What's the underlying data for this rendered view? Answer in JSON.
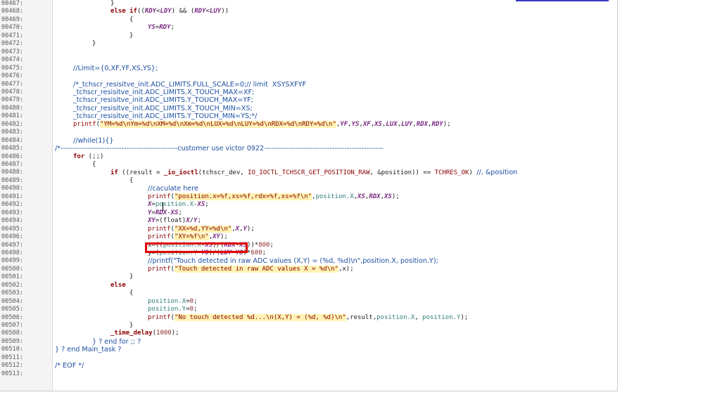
{
  "editor": {
    "lines": [
      {
        "num": "00467:",
        "indent": 157,
        "tokens": [
          {
            "t": "}",
            "c": "p"
          }
        ]
      },
      {
        "num": "00468:",
        "indent": 157,
        "tokens": [
          {
            "t": "else if",
            "c": "k"
          },
          {
            "t": "((",
            "c": "p"
          },
          {
            "t": "RDY",
            "c": "v"
          },
          {
            "t": "<",
            "c": "p"
          },
          {
            "t": "LDY",
            "c": "v"
          },
          {
            "t": ") && (",
            "c": "p"
          },
          {
            "t": "RDY",
            "c": "v"
          },
          {
            "t": "<",
            "c": "p"
          },
          {
            "t": "LUY",
            "c": "v"
          },
          {
            "t": "))",
            "c": "p"
          }
        ]
      },
      {
        "num": "00469:",
        "indent": 184,
        "tokens": [
          {
            "t": "{",
            "c": "p"
          }
        ]
      },
      {
        "num": "00470:",
        "indent": 210,
        "tokens": [
          {
            "t": "YS",
            "c": "v"
          },
          {
            "t": "=",
            "c": "p"
          },
          {
            "t": "RDY",
            "c": "v"
          },
          {
            "t": ";",
            "c": "p"
          }
        ]
      },
      {
        "num": "00471:",
        "indent": 184,
        "tokens": [
          {
            "t": "}",
            "c": "p"
          }
        ]
      },
      {
        "num": "00472:",
        "indent": 131,
        "tokens": [
          {
            "t": "}",
            "c": "p"
          }
        ]
      },
      {
        "num": "00473:",
        "indent": 0,
        "tokens": []
      },
      {
        "num": "00474:",
        "indent": 0,
        "tokens": []
      },
      {
        "num": "00475:",
        "indent": 104,
        "tokens": [
          {
            "t": "//Limit={0,XF,YF,XS,YS};",
            "c": "a"
          }
        ]
      },
      {
        "num": "00476:",
        "indent": 0,
        "tokens": []
      },
      {
        "num": "00477:",
        "indent": 104,
        "tokens": [
          {
            "t": "/*_tchscr_resisitve_init.ADC_LIMITS.FULL_SCALE=0;// limit  XSYSXFYF",
            "c": "a"
          }
        ]
      },
      {
        "num": "00478:",
        "indent": 104,
        "tokens": [
          {
            "t": "_tchscr_resisitve_init.ADC_LIMITS.X_TOUCH_MAX=XF;",
            "c": "a"
          }
        ]
      },
      {
        "num": "00479:",
        "indent": 104,
        "tokens": [
          {
            "t": "_tchscr_resisitve_init.ADC_LIMITS.Y_TOUCH_MAX=YF;",
            "c": "a"
          }
        ]
      },
      {
        "num": "00480:",
        "indent": 104,
        "tokens": [
          {
            "t": "_tchscr_resisitve_init.ADC_LIMITS.X_TOUCH_MIN=XS;",
            "c": "a"
          }
        ]
      },
      {
        "num": "00481:",
        "indent": 104,
        "tokens": [
          {
            "t": "_tchscr_resisitve_init.ADC_LIMITS.Y_TOUCH_MIN=YS;*/",
            "c": "a"
          }
        ]
      },
      {
        "num": "00482:",
        "indent": 104,
        "tokens": [
          {
            "t": "printf",
            "c": "f"
          },
          {
            "t": "(",
            "c": "p"
          },
          {
            "t": "\"YM=%d\\nYm=%d\\nXM=%d\\nXm=%d\\nLUX=%d\\nLUY=%d\\nRDX=%d\\nRDY=%d\\n\"",
            "c": "s"
          },
          {
            "t": ",",
            "c": "p"
          },
          {
            "t": "YF",
            "c": "v"
          },
          {
            "t": ",",
            "c": "p"
          },
          {
            "t": "YS",
            "c": "v"
          },
          {
            "t": ",",
            "c": "p"
          },
          {
            "t": "XF",
            "c": "v"
          },
          {
            "t": ",",
            "c": "p"
          },
          {
            "t": "XS",
            "c": "v"
          },
          {
            "t": ",",
            "c": "p"
          },
          {
            "t": "LUX",
            "c": "v"
          },
          {
            "t": ",",
            "c": "p"
          },
          {
            "t": "LUY",
            "c": "v"
          },
          {
            "t": ",",
            "c": "p"
          },
          {
            "t": "RDX",
            "c": "v"
          },
          {
            "t": ",",
            "c": "p"
          },
          {
            "t": "RDY",
            "c": "v"
          },
          {
            "t": ");",
            "c": "p"
          }
        ]
      },
      {
        "num": "00483:",
        "indent": 0,
        "tokens": []
      },
      {
        "num": "00484:",
        "indent": 104,
        "tokens": [
          {
            "t": "//while(1){}",
            "c": "a"
          }
        ]
      },
      {
        "num": "00485:",
        "indent": 78,
        "tokens": [
          {
            "t": "/*------------------------------------------------customer use victor 0922-------------------------------------------------",
            "c": "c"
          }
        ]
      },
      {
        "num": "00486:",
        "indent": 104,
        "tokens": [
          {
            "t": "for",
            "c": "k"
          },
          {
            "t": " (;;)",
            "c": "p"
          }
        ]
      },
      {
        "num": "00487:",
        "indent": 131,
        "tokens": [
          {
            "t": "{",
            "c": "p"
          }
        ]
      },
      {
        "num": "00488:",
        "indent": 157,
        "tokens": [
          {
            "t": "if",
            "c": "k"
          },
          {
            "t": " ((result = ",
            "c": "p"
          },
          {
            "t": "_io_ioctl",
            "c": "k"
          },
          {
            "t": "(tchscr_dev, ",
            "c": "p"
          },
          {
            "t": "IO_IOCTL_TCHSCR_GET_POSITION_RAW",
            "c": "f"
          },
          {
            "t": ", &position)) == ",
            "c": "p"
          },
          {
            "t": "TCHRES_OK",
            "c": "f"
          },
          {
            "t": ") ",
            "c": "p"
          },
          {
            "t": "//, &position",
            "c": "a"
          }
        ]
      },
      {
        "num": "00489:",
        "indent": 184,
        "tokens": [
          {
            "t": "{",
            "c": "p"
          }
        ]
      },
      {
        "num": "00490:",
        "indent": 210,
        "tokens": [
          {
            "t": "//caculate here",
            "c": "a"
          }
        ]
      },
      {
        "num": "00491:",
        "indent": 210,
        "tokens": [
          {
            "t": "printf",
            "c": "f"
          },
          {
            "t": "(",
            "c": "p"
          },
          {
            "t": "\"position.x=%f,xs=%f,rdx=%f,xs=%f\\n\"",
            "c": "s"
          },
          {
            "t": ",",
            "c": "p"
          },
          {
            "t": "position.X",
            "c": "n"
          },
          {
            "t": ",",
            "c": "p"
          },
          {
            "t": "XS",
            "c": "v"
          },
          {
            "t": ",",
            "c": "p"
          },
          {
            "t": "RDX",
            "c": "v"
          },
          {
            "t": ",",
            "c": "p"
          },
          {
            "t": "XS",
            "c": "v"
          },
          {
            "t": ");",
            "c": "p"
          }
        ]
      },
      {
        "num": "00492:",
        "indent": 210,
        "tokens": [
          {
            "t": "X",
            "c": "v"
          },
          {
            "t": "=",
            "c": "p"
          },
          {
            "t": "position.X",
            "c": "n"
          },
          {
            "t": "-",
            "c": "p"
          },
          {
            "t": "XS",
            "c": "v"
          },
          {
            "t": ";",
            "c": "p"
          }
        ]
      },
      {
        "num": "00493:",
        "indent": 210,
        "tokens": [
          {
            "t": "Y",
            "c": "v"
          },
          {
            "t": "=",
            "c": "p"
          },
          {
            "t": "RDX",
            "c": "v"
          },
          {
            "t": "-",
            "c": "p"
          },
          {
            "t": "XS",
            "c": "v"
          },
          {
            "t": ";",
            "c": "p"
          }
        ]
      },
      {
        "num": "00494:",
        "indent": 210,
        "tokens": [
          {
            "t": "XY",
            "c": "v"
          },
          {
            "t": "=(float)",
            "c": "p"
          },
          {
            "t": "X",
            "c": "v"
          },
          {
            "t": "/",
            "c": "p"
          },
          {
            "t": "Y",
            "c": "v"
          },
          {
            "t": ";",
            "c": "p"
          }
        ]
      },
      {
        "num": "00495:",
        "indent": 210,
        "tokens": [
          {
            "t": "printf",
            "c": "f"
          },
          {
            "t": "(",
            "c": "p"
          },
          {
            "t": "\"XX=%d,YY=%d\\n\"",
            "c": "s"
          },
          {
            "t": ",",
            "c": "p"
          },
          {
            "t": "X",
            "c": "v"
          },
          {
            "t": ",",
            "c": "p"
          },
          {
            "t": "Y",
            "c": "v"
          },
          {
            "t": ");",
            "c": "p"
          }
        ]
      },
      {
        "num": "00496:",
        "indent": 210,
        "tokens": [
          {
            "t": "printf",
            "c": "f"
          },
          {
            "t": "(",
            "c": "p"
          },
          {
            "t": "\"XY=%f\\n\"",
            "c": "s"
          },
          {
            "t": ",",
            "c": "p"
          },
          {
            "t": "XY",
            "c": "v"
          },
          {
            "t": ");",
            "c": "p"
          }
        ]
      },
      {
        "num": "00497:",
        "indent": 210,
        "tokens": [
          {
            "t": "x",
            "c": "p"
          },
          {
            "t": "=((",
            "c": "p"
          },
          {
            "t": "position.X",
            "c": "n"
          },
          {
            "t": "-",
            "c": "p"
          },
          {
            "t": "XS",
            "c": "v"
          },
          {
            "t": ")/(",
            "c": "p"
          },
          {
            "t": "RDX",
            "c": "v"
          },
          {
            "t": "-",
            "c": "p"
          },
          {
            "t": "XS",
            "c": "v"
          },
          {
            "t": "))*",
            "c": "p"
          },
          {
            "t": "800",
            "c": "m"
          },
          {
            "t": ";",
            "c": "p"
          }
        ]
      },
      {
        "num": "00498:",
        "indent": 210,
        "tokens": [
          {
            "t": "y",
            "c": "p"
          },
          {
            "t": "=(",
            "c": "p"
          },
          {
            "t": "position.Y",
            "c": "n"
          },
          {
            "t": "-",
            "c": "p"
          },
          {
            "t": "YS",
            "c": "v"
          },
          {
            "t": ")/(",
            "c": "p"
          },
          {
            "t": "LUY",
            "c": "v"
          },
          {
            "t": "-",
            "c": "p"
          },
          {
            "t": "YS",
            "c": "v"
          },
          {
            "t": ")*",
            "c": "p"
          },
          {
            "t": "600",
            "c": "m"
          },
          {
            "t": ";",
            "c": "p"
          }
        ]
      },
      {
        "num": "00499:",
        "indent": 210,
        "tokens": [
          {
            "t": "//printf(\"Touch detected in raw ADC values (X,Y) = (%d, %d)\\n\",position.X, position.Y);",
            "c": "a"
          }
        ]
      },
      {
        "num": "00500:",
        "indent": 210,
        "tokens": [
          {
            "t": "printf",
            "c": "f"
          },
          {
            "t": "(",
            "c": "p"
          },
          {
            "t": "\"Touch detected in raw ADC values X = %d\\n\"",
            "c": "s"
          },
          {
            "t": ",x);",
            "c": "p"
          }
        ]
      },
      {
        "num": "00501:",
        "indent": 184,
        "tokens": [
          {
            "t": "}",
            "c": "p"
          }
        ]
      },
      {
        "num": "00502:",
        "indent": 157,
        "tokens": [
          {
            "t": "else",
            "c": "k"
          }
        ]
      },
      {
        "num": "00503:",
        "indent": 184,
        "tokens": [
          {
            "t": "{",
            "c": "p"
          }
        ]
      },
      {
        "num": "00504:",
        "indent": 210,
        "tokens": [
          {
            "t": "position.X",
            "c": "n"
          },
          {
            "t": "=",
            "c": "p"
          },
          {
            "t": "0",
            "c": "m"
          },
          {
            "t": ";",
            "c": "p"
          }
        ]
      },
      {
        "num": "00505:",
        "indent": 210,
        "tokens": [
          {
            "t": "position.Y",
            "c": "n"
          },
          {
            "t": "=",
            "c": "p"
          },
          {
            "t": "0",
            "c": "m"
          },
          {
            "t": ";",
            "c": "p"
          }
        ]
      },
      {
        "num": "00506:",
        "indent": 210,
        "tokens": [
          {
            "t": "printf",
            "c": "f"
          },
          {
            "t": "(",
            "c": "p"
          },
          {
            "t": "\"No touch detected %d...\\n(X,Y) = (%d, %d)\\n\"",
            "c": "s"
          },
          {
            "t": ",result,",
            "c": "p"
          },
          {
            "t": "position.X",
            "c": "n"
          },
          {
            "t": ", ",
            "c": "p"
          },
          {
            "t": "position.Y",
            "c": "n"
          },
          {
            "t": ");",
            "c": "p"
          }
        ]
      },
      {
        "num": "00507:",
        "indent": 184,
        "tokens": [
          {
            "t": "}",
            "c": "p"
          }
        ]
      },
      {
        "num": "00508:",
        "indent": 157,
        "tokens": [
          {
            "t": "_time_delay",
            "c": "k"
          },
          {
            "t": "(",
            "c": "p"
          },
          {
            "t": "1000",
            "c": "m"
          },
          {
            "t": ");",
            "c": "p"
          }
        ]
      },
      {
        "num": "00509:",
        "indent": 131,
        "tokens": [
          {
            "t": "} ? end for ;; ?",
            "c": "c"
          }
        ]
      },
      {
        "num": "00510:",
        "indent": 78,
        "tokens": [
          {
            "t": "} ? end Main_task ?",
            "c": "c"
          }
        ]
      },
      {
        "num": "00511:",
        "indent": 0,
        "tokens": []
      },
      {
        "num": "00512:",
        "indent": 78,
        "tokens": [
          {
            "t": "/* EOF */",
            "c": "c"
          }
        ]
      },
      {
        "num": "00513:",
        "indent": 0,
        "tokens": []
      }
    ]
  },
  "colors": {
    "highlight_box": "#e00000",
    "string_background": "#fff3b3",
    "gutter_background": "#f4f4f4"
  }
}
